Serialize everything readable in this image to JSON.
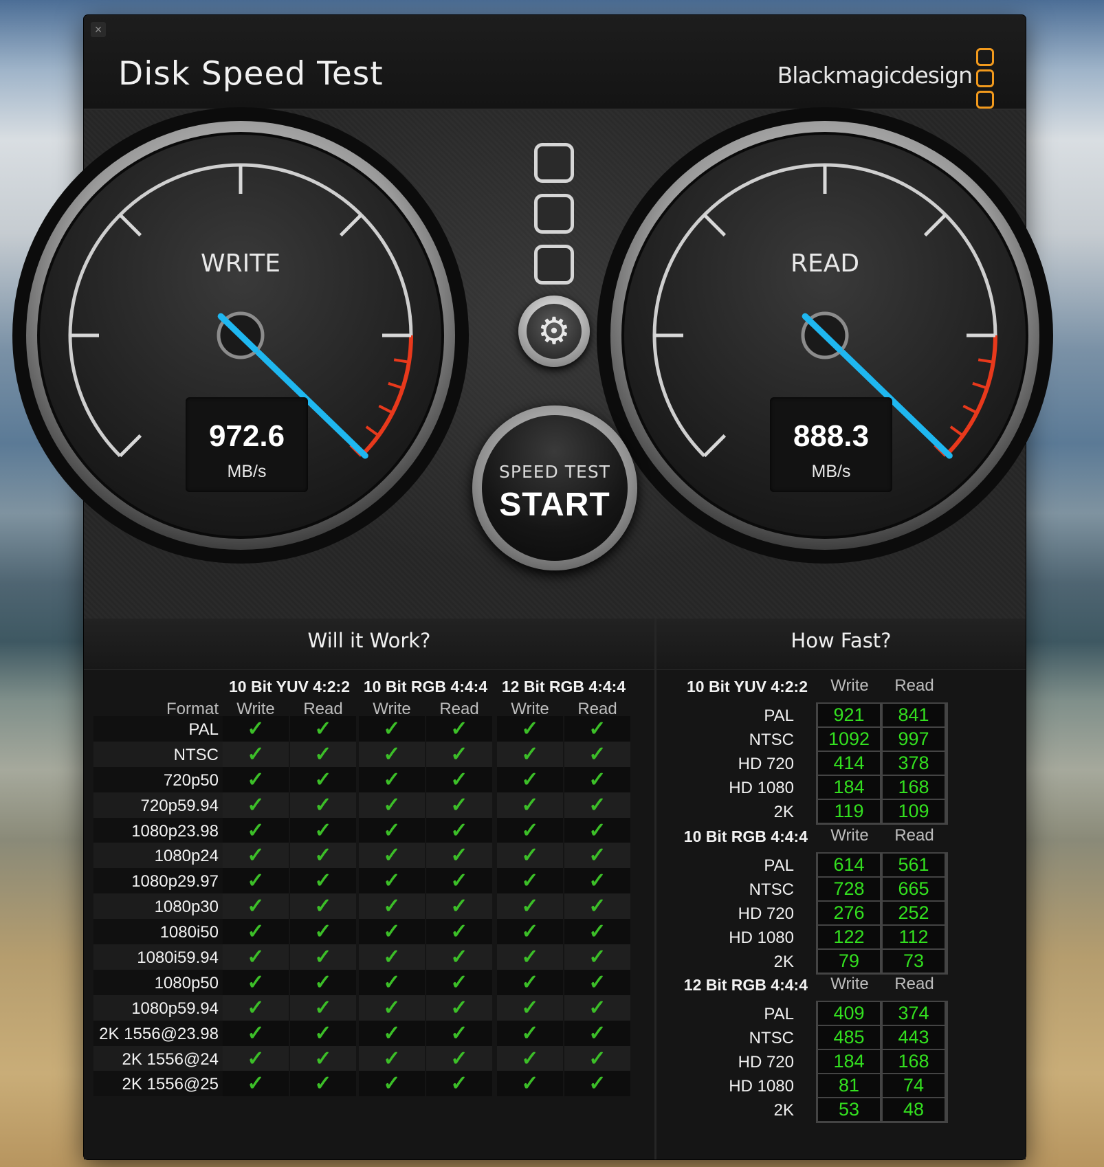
{
  "window": {
    "title": "Disk Speed Test",
    "close_glyph": "×",
    "brand": "Blackmagicdesign",
    "brand_logo": "three-rounded-squares-icon",
    "brand_color": "#f29a1d"
  },
  "gauges": {
    "write": {
      "label": "WRITE",
      "value": "972.6",
      "unit": "MB/s",
      "needle_color": "#1fb7f0"
    },
    "read": {
      "label": "READ",
      "value": "888.3",
      "unit": "MB/s",
      "needle_color": "#1fb7f0"
    }
  },
  "controls": {
    "settings_icon": "gear-icon",
    "start_sub": "SPEED TEST",
    "start_main": "START"
  },
  "will_it_work": {
    "title": "Will it Work?",
    "format_header": "Format",
    "groups": [
      "10 Bit YUV 4:2:2",
      "10 Bit RGB 4:4:4",
      "12 Bit RGB 4:4:4"
    ],
    "columns": [
      "Write",
      "Read",
      "Write",
      "Read",
      "Write",
      "Read"
    ],
    "check_glyph": "✓",
    "check_color": "#3cbf28",
    "rows": [
      {
        "format": "PAL"
      },
      {
        "format": "NTSC"
      },
      {
        "format": "720p50"
      },
      {
        "format": "720p59.94"
      },
      {
        "format": "1080p23.98"
      },
      {
        "format": "1080p24"
      },
      {
        "format": "1080p29.97"
      },
      {
        "format": "1080p30"
      },
      {
        "format": "1080i50"
      },
      {
        "format": "1080i59.94"
      },
      {
        "format": "1080p50"
      },
      {
        "format": "1080p59.94"
      },
      {
        "format": "2K 1556@23.98"
      },
      {
        "format": "2K 1556@24"
      },
      {
        "format": "2K 1556@25"
      }
    ]
  },
  "how_fast": {
    "title": "How Fast?",
    "value_color": "#33e01f",
    "sections": [
      {
        "name": "10 Bit YUV 4:2:2",
        "write_header": "Write",
        "read_header": "Read",
        "rows": [
          {
            "label": "PAL",
            "write": "921",
            "read": "841"
          },
          {
            "label": "NTSC",
            "write": "1092",
            "read": "997"
          },
          {
            "label": "HD 720",
            "write": "414",
            "read": "378"
          },
          {
            "label": "HD 1080",
            "write": "184",
            "read": "168"
          },
          {
            "label": "2K",
            "write": "119",
            "read": "109"
          }
        ]
      },
      {
        "name": "10 Bit RGB 4:4:4",
        "write_header": "Write",
        "read_header": "Read",
        "rows": [
          {
            "label": "PAL",
            "write": "614",
            "read": "561"
          },
          {
            "label": "NTSC",
            "write": "728",
            "read": "665"
          },
          {
            "label": "HD 720",
            "write": "276",
            "read": "252"
          },
          {
            "label": "HD 1080",
            "write": "122",
            "read": "112"
          },
          {
            "label": "2K",
            "write": "79",
            "read": "73"
          }
        ]
      },
      {
        "name": "12 Bit RGB 4:4:4",
        "write_header": "Write",
        "read_header": "Read",
        "rows": [
          {
            "label": "PAL",
            "write": "409",
            "read": "374"
          },
          {
            "label": "NTSC",
            "write": "485",
            "read": "443"
          },
          {
            "label": "HD 720",
            "write": "184",
            "read": "168"
          },
          {
            "label": "HD 1080",
            "write": "81",
            "read": "74"
          },
          {
            "label": "2K",
            "write": "53",
            "read": "48"
          }
        ]
      }
    ]
  }
}
